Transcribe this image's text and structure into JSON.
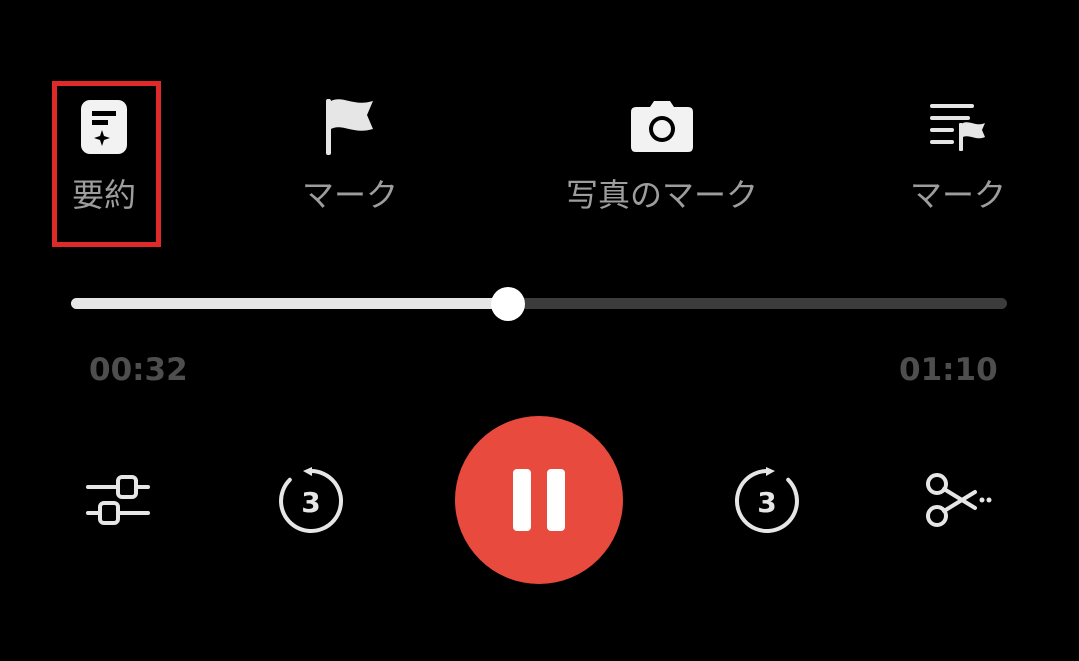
{
  "actions": [
    {
      "label": "要約",
      "icon": "summary-document-icon",
      "selected": true
    },
    {
      "label": "マーク",
      "icon": "flag-icon"
    },
    {
      "label": "写真のマーク",
      "icon": "camera-icon"
    },
    {
      "label": "マーク",
      "icon": "mark-list-icon"
    }
  ],
  "player": {
    "elapsed": "00:32",
    "total": "01:10",
    "progress_fraction": 0.467,
    "skip_back_seconds": "3",
    "skip_forward_seconds": "3"
  },
  "controls": {
    "settings_icon": "sliders-icon",
    "skip_back_icon": "rewind-3-icon",
    "play_icon": "pause-icon",
    "skip_forward_icon": "forward-3-icon",
    "trim_icon": "scissors-icon"
  },
  "colors": {
    "background": "#000000",
    "accent": "#e84a3e",
    "highlight": "#e02a2a",
    "label": "#9d9d9d",
    "time": "#4e4e4e"
  }
}
